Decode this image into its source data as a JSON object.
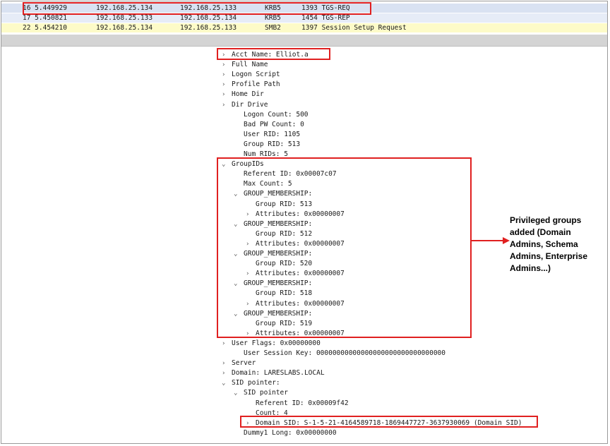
{
  "packets": [
    {
      "no_time": "16 5.449929",
      "src": "192.168.25.134",
      "dst": "192.168.25.133",
      "proto": "KRB5",
      "info": "1393 TGS-REQ"
    },
    {
      "no_time": "17 5.450821",
      "src": "192.168.25.133",
      "dst": "192.168.25.134",
      "proto": "KRB5",
      "info": "1454 TGS-REP"
    },
    {
      "no_time": "22 5.454210",
      "src": "192.168.25.134",
      "dst": "192.168.25.133",
      "proto": "SMB2",
      "info": "1397 Session Setup Request"
    }
  ],
  "tree": [
    {
      "text": "Acct Name: Elliot.a",
      "arrow": "›"
    },
    {
      "text": "Full Name",
      "arrow": "›"
    },
    {
      "text": "Logon Script",
      "arrow": "›"
    },
    {
      "text": "Profile Path",
      "arrow": "›"
    },
    {
      "text": "Home Dir",
      "arrow": "›"
    },
    {
      "text": "Dir Drive",
      "arrow": "›"
    },
    {
      "text": "Logon Count: 500",
      "arrow": ""
    },
    {
      "text": "Bad PW Count: 0",
      "arrow": ""
    },
    {
      "text": "User RID: 1105",
      "arrow": ""
    },
    {
      "text": "Group RID: 513",
      "arrow": ""
    },
    {
      "text": "Num RIDs: 5",
      "arrow": ""
    },
    {
      "text": "GroupIDs",
      "arrow": "⌄"
    },
    {
      "text": "Referent ID: 0x00007c07",
      "arrow": ""
    },
    {
      "text": "Max Count: 5",
      "arrow": ""
    },
    {
      "text": "GROUP_MEMBERSHIP:",
      "arrow": "⌄"
    },
    {
      "text": "Group RID: 513",
      "arrow": ""
    },
    {
      "text": "Attributes: 0x00000007",
      "arrow": "›"
    },
    {
      "text": "GROUP_MEMBERSHIP:",
      "arrow": "⌄"
    },
    {
      "text": "Group RID: 512",
      "arrow": ""
    },
    {
      "text": "Attributes: 0x00000007",
      "arrow": "›"
    },
    {
      "text": "GROUP_MEMBERSHIP:",
      "arrow": "⌄"
    },
    {
      "text": "Group RID: 520",
      "arrow": ""
    },
    {
      "text": "Attributes: 0x00000007",
      "arrow": "›"
    },
    {
      "text": "GROUP_MEMBERSHIP:",
      "arrow": "⌄"
    },
    {
      "text": "Group RID: 518",
      "arrow": ""
    },
    {
      "text": "Attributes: 0x00000007",
      "arrow": "›"
    },
    {
      "text": "GROUP_MEMBERSHIP:",
      "arrow": "⌄"
    },
    {
      "text": "Group RID: 519",
      "arrow": ""
    },
    {
      "text": "Attributes: 0x00000007",
      "arrow": "›"
    },
    {
      "text": "User Flags: 0x00000000",
      "arrow": "›"
    },
    {
      "text": "User Session Key: 00000000000000000000000000000000",
      "arrow": ""
    },
    {
      "text": "Server",
      "arrow": "›"
    },
    {
      "text": "Domain: LARESLABS.LOCAL",
      "arrow": "›"
    },
    {
      "text": "SID pointer:",
      "arrow": "⌄"
    },
    {
      "text": "SID pointer",
      "arrow": "⌄"
    },
    {
      "text": "Referent ID: 0x00009f42",
      "arrow": ""
    },
    {
      "text": "Count: 4",
      "arrow": ""
    },
    {
      "text": "Domain SID: S-1-5-21-4164589718-1869447727-3637930069  (Domain SID)",
      "arrow": "›"
    },
    {
      "text": "Dummy1 Long: 0x00000000",
      "arrow": ""
    }
  ],
  "annotation": {
    "line1": "Privileged groups",
    "line2": "added (Domain",
    "line3": "Admins, Schema",
    "line4": "Admins, Enterprise",
    "line5": "Admins...)"
  },
  "colors": {
    "highlight": "#e02020"
  }
}
